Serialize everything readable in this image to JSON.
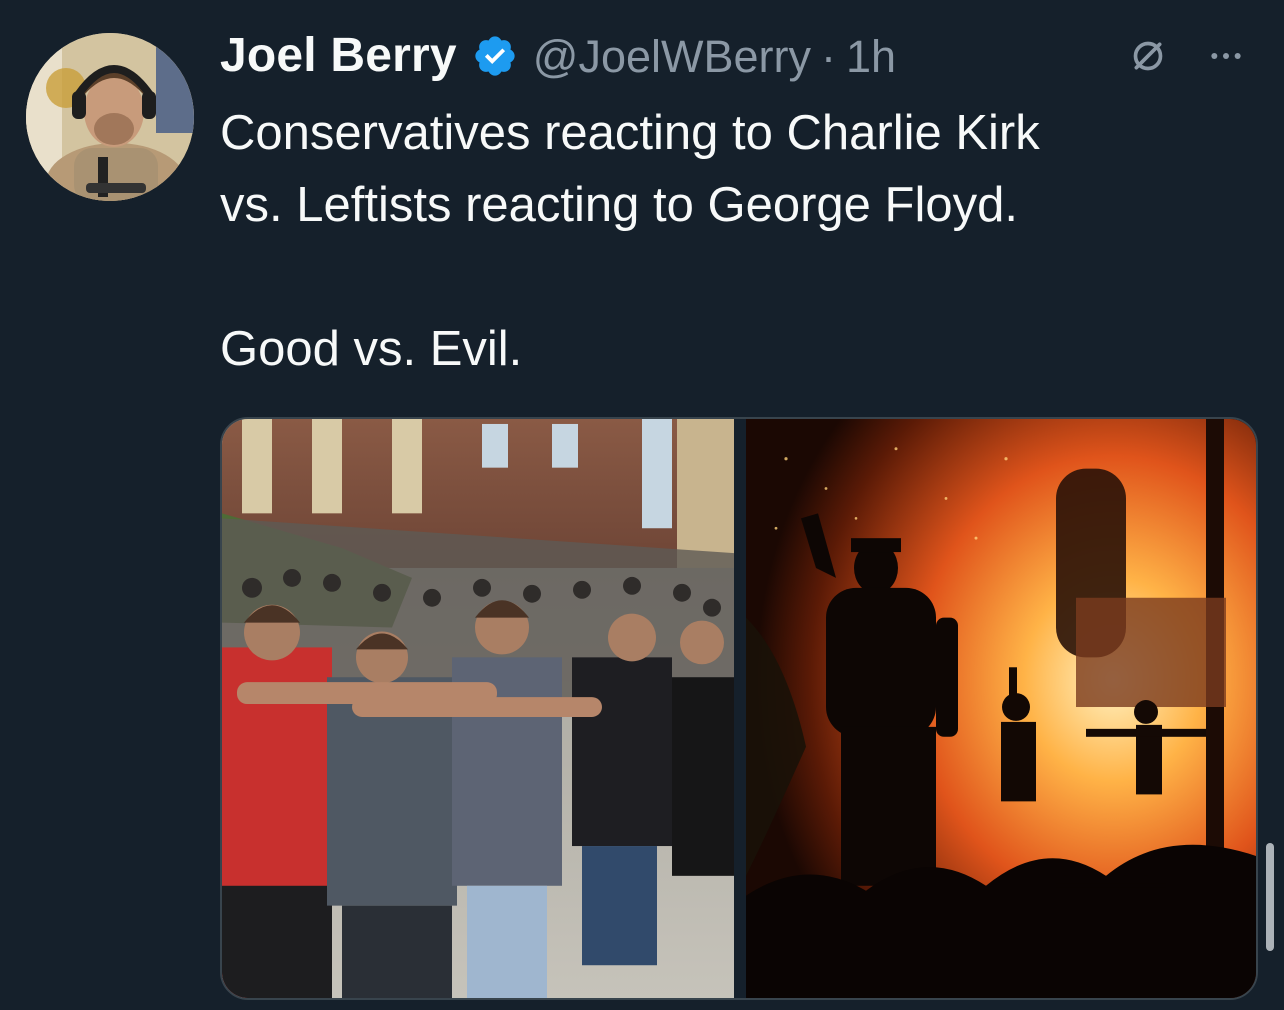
{
  "tweet": {
    "author": {
      "display_name": "Joel Berry",
      "handle": "@JoelWBerry",
      "verified": true
    },
    "separator": "·",
    "timestamp": "1h",
    "text_lines": [
      "Conservatives reacting to Charlie Kirk",
      "vs. Leftists reacting to George Floyd.",
      "Good vs. Evil."
    ],
    "media": [
      {
        "position": "left",
        "description": "crowd-praying-photo"
      },
      {
        "position": "right",
        "description": "fire-protest-photo"
      }
    ]
  },
  "icons": {
    "verified": "verified-badge-icon",
    "grok": "grok-icon",
    "more": "more-icon"
  },
  "colors": {
    "background": "#15202b",
    "text_primary": "#f7f9f9",
    "text_secondary": "#8b98a5",
    "verified_blue": "#1d9bf0",
    "border": "#38444d"
  }
}
